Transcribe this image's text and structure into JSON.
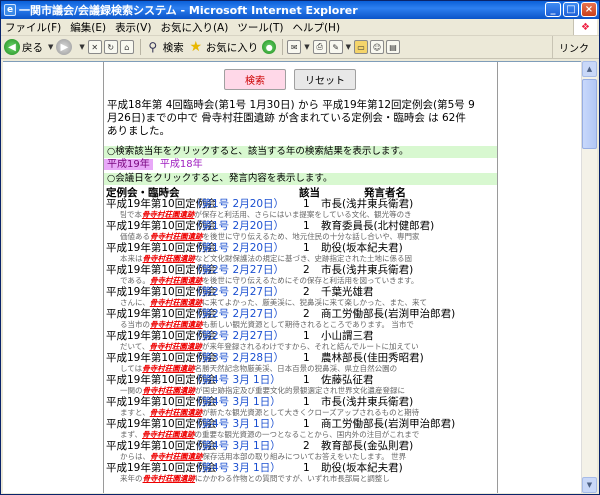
{
  "window": {
    "title": "一関市議会/会議録検索システム - Microsoft Internet Explorer"
  },
  "menu": [
    "ファイル(F)",
    "編集(E)",
    "表示(V)",
    "お気に入り(A)",
    "ツール(T)",
    "ヘルプ(H)"
  ],
  "toolbar": {
    "back": "戻る",
    "search": "検索",
    "favorites": "お気に入り",
    "links": "リンク"
  },
  "page": {
    "search_button": "検索",
    "reset_button": "リセット",
    "summary": "平成18年第 4回臨時会(第1号 1月30日) から 平成19年第12回定例会(第5号 9月26日)までの中で 骨寺村荘園遺跡 が含まれている定例会・臨時会 は 62件 ありました。",
    "notice_year": "○検索該当年をクリックすると、該当する年の検索結果を表示します。",
    "years": [
      "平成19年",
      "平成18年"
    ],
    "notice_date": "○会議日をクリックすると、発言内容を表示します。",
    "headers": {
      "meeting": "定例会・臨時会",
      "number": "該当",
      "speaker": "発言者名"
    },
    "keyword": "骨寺村荘園遺跡",
    "results": [
      {
        "meeting": "平成19年第10回定例会",
        "date": "（第1号 2月20日）",
        "num": "1",
        "speaker": "市長(浅井東兵衛君)",
        "pre": "팀で本",
        "post": "が保存と利活用、さらにはいま提案をしている文化、観光等のき"
      },
      {
        "meeting": "平成19年第10回定例会",
        "date": "（第1号 2月20日）",
        "num": "1",
        "speaker": "教育委員長(北村健郎君)",
        "pre": "価値ある",
        "post": "を後世に守り伝えるため、地元住民の十分な話し合いや、専門家"
      },
      {
        "meeting": "平成19年第10回定例会",
        "date": "（第1号 2月20日）",
        "num": "1",
        "speaker": "助役(坂本紀夫君)",
        "pre": "本来は",
        "post": "など文化財保護法の規定に基づき、史跡指定された土地に係る固"
      },
      {
        "meeting": "平成19年第10回定例会",
        "date": "（第2号 2月27日）",
        "num": "2",
        "speaker": "市長(浅井東兵衛君)",
        "pre": "である。",
        "post": "を後世に守り伝えるためにその保存と利活用を図っていきます。"
      },
      {
        "meeting": "平成19年第10回定例会",
        "date": "（第2号 2月27日）",
        "num": "2",
        "speaker": "千葉光雄君",
        "pre": "さんに、",
        "post": "に来てよかった、厳美渓に、猊鼻渓に来て楽しかった、また、来て"
      },
      {
        "meeting": "平成19年第10回定例会",
        "date": "（第2号 2月27日）",
        "num": "2",
        "speaker": "商工労働部長(岩渕甲治郎君)",
        "pre": "る当市の",
        "post": "も新しい観光資源として期待されるところであります。 当市で"
      },
      {
        "meeting": "平成19年第10回定例会",
        "date": "（第2号 2月27日）",
        "num": "1",
        "speaker": "小山謂三君",
        "pre": "だいて、",
        "post": "が来年登録されるわけですから、それと結んでルートに加えてい"
      },
      {
        "meeting": "平成19年第10回定例会",
        "date": "（第3号 2月28日）",
        "num": "1",
        "speaker": "農林部長(佳田秀昭君)",
        "pre": "しては",
        "post": "名勝天然記念物厳美渓、日本百景の猊鼻渓、県立自然公園の"
      },
      {
        "meeting": "平成19年第10回定例会",
        "date": "（第4号 3月 1日）",
        "num": "1",
        "speaker": "佐藤弘征君",
        "pre": "一関の",
        "post": "が国史跡指定及び重要文化的景観選定され世界文化遺産登録に"
      },
      {
        "meeting": "平成19年第10回定例会",
        "date": "（第4号 3月 1日）",
        "num": "1",
        "speaker": "市長(浅井東兵衛君)",
        "pre": "ますと、",
        "post": "が新たな観光資源として大きくクローズアップされるものと期待"
      },
      {
        "meeting": "平成19年第10回定例会",
        "date": "（第4号 3月 1日）",
        "num": "1",
        "speaker": "商工労働部長(岩渕甲治郎君)",
        "pre": "まず、",
        "post": "の重要な観光資源の一つとなることから、国内外の注目がこれまで"
      },
      {
        "meeting": "平成19年第10回定例会",
        "date": "（第4号 3月 1日）",
        "num": "2",
        "speaker": "教育部長(金弘則君)",
        "pre": "からは、",
        "post": "保存活用本部の取り組みについてお答えをいたします。 世界"
      },
      {
        "meeting": "平成19年第10回定例会",
        "date": "（第4号 3月 1日）",
        "num": "1",
        "speaker": "助役(坂本紀夫君)",
        "pre": "来年の",
        "post": "にかかわる作物との質問ですが、いずれ市長部局と調整し"
      }
    ]
  }
}
